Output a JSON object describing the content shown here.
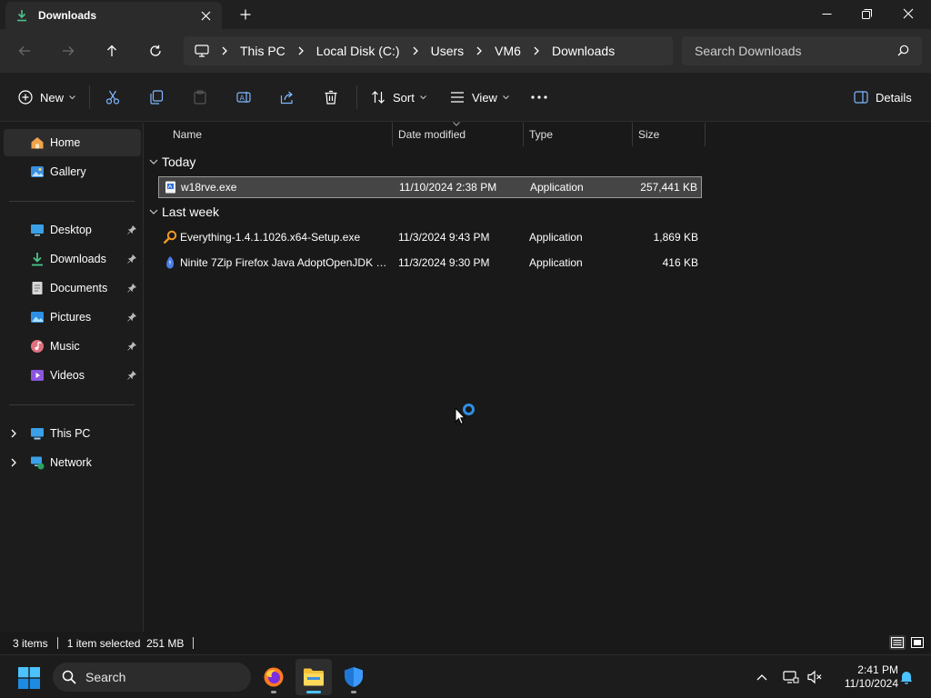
{
  "window": {
    "tab_title": "Downloads",
    "tab_icon": "download-icon"
  },
  "address": {
    "breadcrumbs": [
      "This PC",
      "Local Disk (C:)",
      "Users",
      "VM6",
      "Downloads"
    ],
    "search_placeholder": "Search Downloads"
  },
  "toolbar": {
    "new_label": "New",
    "sort_label": "Sort",
    "view_label": "View",
    "details_label": "Details"
  },
  "sidebar": {
    "items": [
      {
        "label": "Home",
        "icon": "home-icon",
        "active": true
      },
      {
        "label": "Gallery",
        "icon": "gallery-icon"
      },
      {
        "label": "Desktop",
        "icon": "desktop-icon",
        "pinned": true
      },
      {
        "label": "Downloads",
        "icon": "download-icon",
        "pinned": true
      },
      {
        "label": "Documents",
        "icon": "documents-icon",
        "pinned": true
      },
      {
        "label": "Pictures",
        "icon": "pictures-icon",
        "pinned": true
      },
      {
        "label": "Music",
        "icon": "music-icon",
        "pinned": true
      },
      {
        "label": "Videos",
        "icon": "videos-icon",
        "pinned": true
      },
      {
        "label": "This PC",
        "icon": "this-pc-icon",
        "expandable": true
      },
      {
        "label": "Network",
        "icon": "network-icon",
        "expandable": true
      }
    ]
  },
  "filelist": {
    "columns": [
      "Name",
      "Date modified",
      "Type",
      "Size"
    ],
    "groups": [
      {
        "label": "Today",
        "files": [
          {
            "name": "w18rve.exe",
            "date": "11/10/2024 2:38 PM",
            "type": "Application",
            "size": "257,441 KB",
            "selected": true,
            "icon": "exe-icon"
          }
        ]
      },
      {
        "label": "Last week",
        "files": [
          {
            "name": "Everything-1.4.1.1026.x64-Setup.exe",
            "date": "11/3/2024 9:43 PM",
            "type": "Application",
            "size": "1,869 KB",
            "icon": "everything-search-icon"
          },
          {
            "name": "Ninite 7Zip Firefox Java AdoptOpenJDK x...",
            "date": "11/3/2024 9:30 PM",
            "type": "Application",
            "size": "416 KB",
            "icon": "ninite-icon"
          }
        ]
      }
    ]
  },
  "status": {
    "item_count": "3 items",
    "selection": "1 item selected  251 MB"
  },
  "taskbar": {
    "search_label": "Search",
    "time": "2:41 PM",
    "date": "11/10/2024"
  },
  "colors": {
    "accent": "#2f8fe5",
    "folder": "#f3c13a",
    "selection": "#454545"
  }
}
